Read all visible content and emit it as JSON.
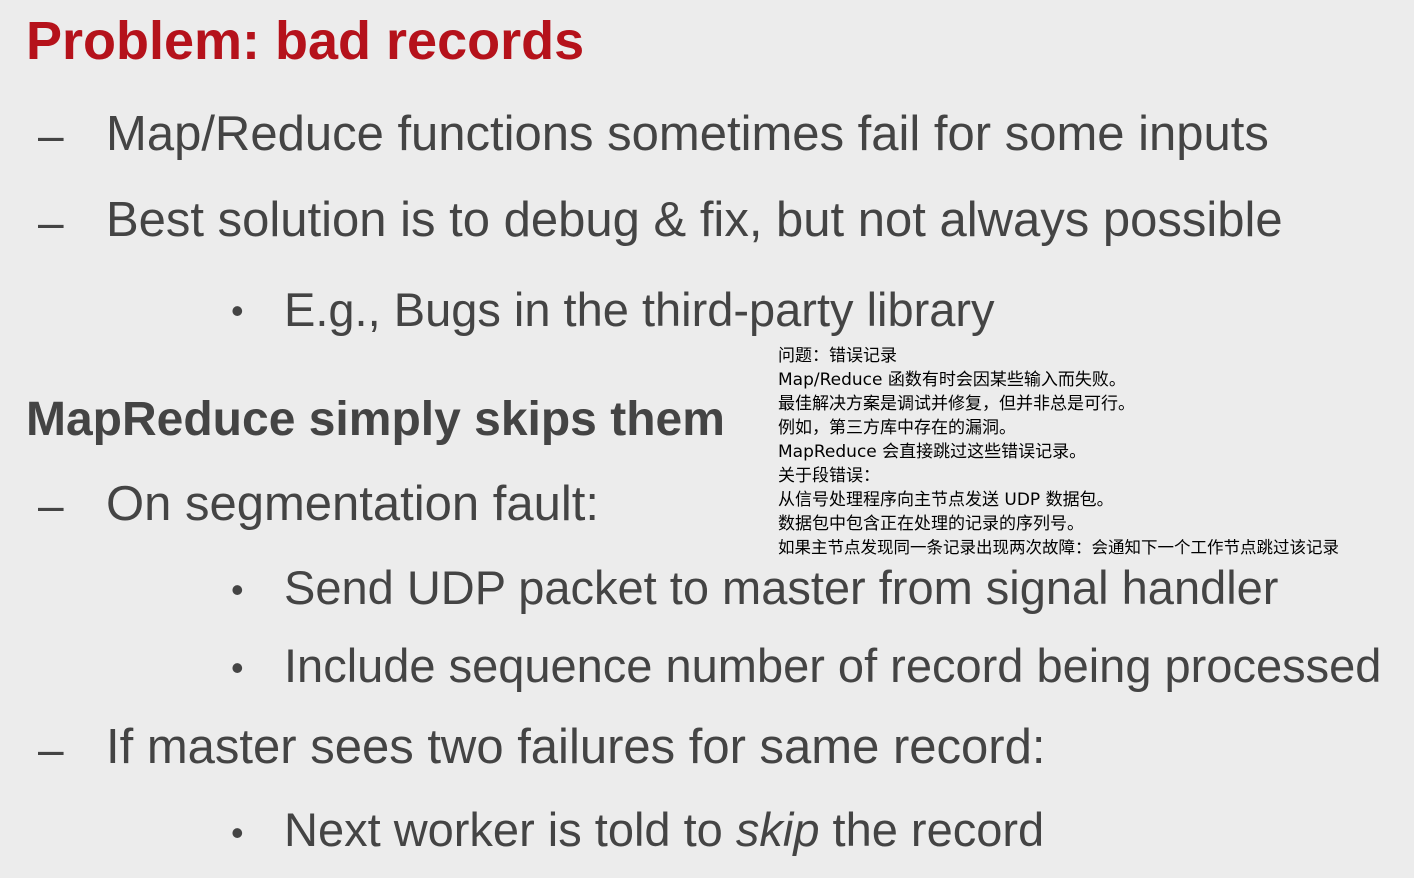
{
  "slide": {
    "title": "Problem: bad records",
    "dash_symbol": "–",
    "bullet_symbol": "•",
    "points_1": [
      "Map/Reduce functions sometimes fail for some inputs",
      "Best solution is to debug & fix, but not always possible"
    ],
    "sub_point_1": "E.g., Bugs in the third-party library",
    "heading_2": "MapReduce simply skips them",
    "point_segfault": "On segmentation fault:",
    "segfault_subs": [
      "Send UDP packet to master from signal handler",
      "Include sequence number of record being processed"
    ],
    "point_master": "If master sees two failures for same record:",
    "master_sub": {
      "before": "Next worker is told to ",
      "emphasis": "skip",
      "after": " the record"
    }
  },
  "subtitle_overlay": {
    "lines": [
      "问题：错误记录",
      "Map/Reduce 函数有时会因某些输入而失败。",
      "最佳解决方案是调试并修复，但并非总是可行。",
      "例如，第三方库中存在的漏洞。",
      "MapReduce 会直接跳过这些错误记录。",
      "关于段错误：",
      "从信号处理程序向主节点发送 UDP 数据包。",
      "数据包中包含正在处理的记录的序列号。",
      "如果主节点发现同一条记录出现两次故障：会通知下一个工作节点跳过该记录"
    ]
  },
  "colors": {
    "title": "#b5121b",
    "body_text": "#444444",
    "background": "#ececec",
    "overlay_text": "#000000"
  }
}
